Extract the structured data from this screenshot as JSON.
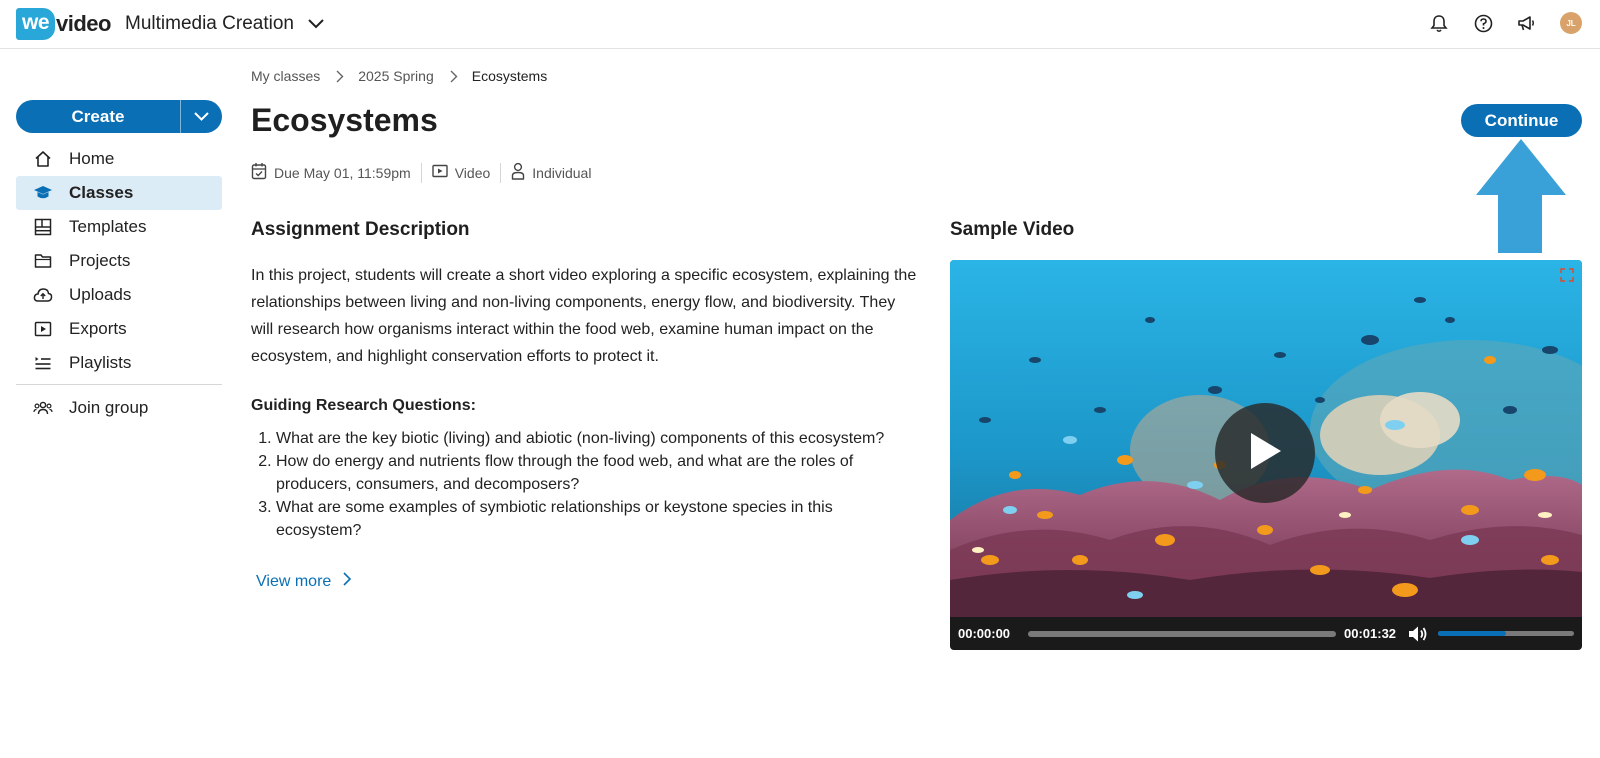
{
  "brand": {
    "logo_we": "we",
    "logo_video": "video"
  },
  "header": {
    "workspace": "Multimedia Creation",
    "avatar_initials": "JL"
  },
  "sidebar": {
    "create_label": "Create",
    "items": [
      {
        "label": "Home",
        "icon": "home-icon"
      },
      {
        "label": "Classes",
        "icon": "classes-icon",
        "active": true
      },
      {
        "label": "Templates",
        "icon": "templates-icon"
      },
      {
        "label": "Projects",
        "icon": "folder-icon"
      },
      {
        "label": "Uploads",
        "icon": "cloud-upload-icon"
      },
      {
        "label": "Exports",
        "icon": "export-icon"
      },
      {
        "label": "Playlists",
        "icon": "playlist-icon"
      }
    ],
    "join_group": "Join group"
  },
  "breadcrumb": [
    "My classes",
    "2025 Spring",
    "Ecosystems"
  ],
  "assignment": {
    "title": "Ecosystems",
    "continue_label": "Continue",
    "meta": {
      "due": "Due May 01, 11:59pm",
      "type": "Video",
      "mode": "Individual"
    },
    "description_title": "Assignment Description",
    "description": "In this project, students will create a short video exploring a specific ecosystem, explaining the relationships between living and non-living components, energy flow, and biodiversity. They will research how organisms interact within the food web, examine human impact on the ecosystem, and highlight conservation efforts to protect it.",
    "guiding_title": "Guiding Research Questions:",
    "questions": [
      "What are the key biotic (living) and abiotic (non-living) components of this ecosystem?",
      "How do energy and nutrients flow through the food web, and what are the roles of producers, consumers, and decomposers?",
      "What are some examples of symbiotic relationships or keystone species in this ecosystem?"
    ],
    "view_more": "View more"
  },
  "sample_video": {
    "title": "Sample Video",
    "current_time": "00:00:00",
    "duration": "00:01:32",
    "progress": 0,
    "volume": 0.5
  },
  "colors": {
    "accent": "#0a6fb4",
    "active_bg": "#dcecf7",
    "arrow": "#3aa0d8"
  }
}
